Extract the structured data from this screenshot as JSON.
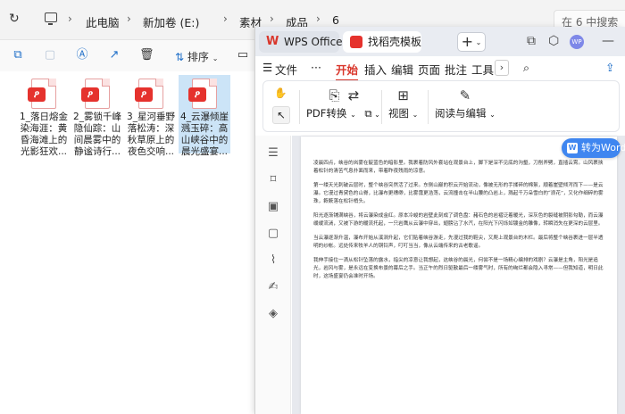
{
  "explorer": {
    "breadcrumb": [
      "此电脑",
      "新加卷 (E:)",
      "素材",
      "成品",
      "6"
    ],
    "search_placeholder": "在 6 中搜索",
    "sort_label": "排序",
    "files": [
      {
        "name": "1_落日熔金染海涯：黄昏海滩上的光影狂欢..."
      },
      {
        "name": "2_雾锁千峰隐仙踪：山间晨雾中的静谧诗行..."
      },
      {
        "name": "3_星河垂野落松涛：深秋草原上的夜色交响..."
      },
      {
        "name": "4_云瀑倾崖溅玉碎：高山峡谷中的晨光盛宴...",
        "selected": true
      }
    ]
  },
  "wps": {
    "tabs": [
      {
        "label": "WPS Office"
      },
      {
        "label": "找稻壳模板"
      }
    ],
    "avatar_text": "WP",
    "menu": {
      "file": "文件",
      "more": "···",
      "items": [
        "开始",
        "插入",
        "编辑",
        "页面",
        "批注",
        "工具"
      ],
      "active": "开始"
    },
    "ribbon": {
      "pdf_convert": "PDF转换",
      "view": "视图",
      "read_edit": "阅读与编辑"
    },
    "to_word": "转为Word",
    "doc_paragraphs": [
      "凌晨四点，峡谷的岚雾在靛蓝色的暗影里。我裹着防风外套站在观景台上，脚下是深不见底的沟壑，刀削斧劈，直插云霄。山风裹挟着松针的清苦气息扑面而来，带着昨夜残雨的凉意。",
      "第一缕天光刺破云层时，整个峡谷突然活了过来。东侧山巅的积云开始流动，像被无形的手揉碎的棉絮，顺着崖壁倾泻而下——是云瀑。它漫过青黛色的山脊，比瀑布更缥缈，比雾霭更浩荡，云流撞击在半山腰的凸岩上，溅起千万朵雪白的“浪花”，又化作细碎的雾珠，簌簌落在松针梢头。",
      "阳光逐渐铺满峡谷，将云瀑染成金红。原本冷峻的岩壁此刻成了调色盘：赭石色的岩褶泛着暖光，深灰色的裂缝被阴影勾勒，而云瀑缓缓流淌，又被下游的暖流托起，一只岩鹰从云瀑中穿出，翅膀沾了水汽，在阳光下闪烁如镀金的雕像，转瞬消失在更深的云层里。",
      "当云瀑逐渐升温，瀑布开始从溪涧升起，它们贴着峡谷游走，先漫过我的鞋尖，又爬上观景台的木栏。最后将整个峡谷裹进一层半透明的纱帐。远处传来牧羊人的铜铃声，叮叮当当，像从云端传来的古老歌谣。",
      "我伸手接住一滴从松针坠落的露水，指尖的凉意让我想起，这峡谷的晨光，何尝不是一场精心编排的戏剧？云瀑是主角，阳光是追光，岩风与雾，是永远在变换布景的幕后之手。当正午的烈日驱散最后一缕雾气时，所有的绚烂都会隐入寻常——但我知道，明日此时，这场盛宴仍会准时开场。"
    ]
  }
}
